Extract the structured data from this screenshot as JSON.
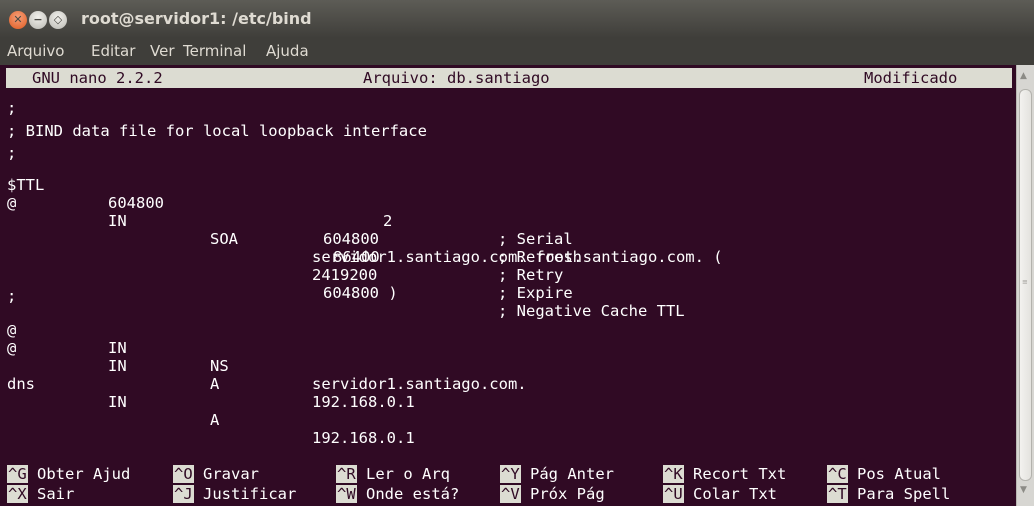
{
  "window": {
    "title": "root@servidor1: /etc/bind",
    "close_glyph": "✕",
    "min_glyph": "−",
    "max_glyph": "◇"
  },
  "menu": [
    "Arquivo",
    "Editar",
    "Ver",
    "Terminal",
    "Ajuda"
  ],
  "nano": {
    "version": "GNU nano 2.2.2",
    "file": "Arquivo: db.santiago",
    "status": "Modificado"
  },
  "file_lines": {
    "l1": ";",
    "l2": "; BIND data file for local loopback interface",
    "l3": ";",
    "l4a": "$TTL",
    "l4b": "604800",
    "l5a": "@",
    "l5b": "IN",
    "l5c": "SOA",
    "l5d": "servidor1.santiago.com. root.santiago.com. (",
    "l6a": "2",
    "l6b": "; Serial",
    "l7a": "604800",
    "l7b": "; Refresh",
    "l8a": "86400",
    "l8b": "; Retry",
    "l9a": "2419200",
    "l9b": "; Expire",
    "l10a": "604800 )",
    "l10b": "; Negative Cache TTL",
    "l11": ";",
    "l12a": "@",
    "l12b": "IN",
    "l12c": "NS",
    "l12d": "servidor1.santiago.com.",
    "l13a": "@",
    "l13b": "IN",
    "l13c": "A",
    "l13d": "192.168.0.1",
    "l15a": "dns",
    "l15b": "IN",
    "l15c": "A",
    "l15d": "192.168.0.1"
  },
  "shortcuts": {
    "row1": [
      {
        "key": "^G",
        "label": "Obter Ajud"
      },
      {
        "key": "^O",
        "label": "Gravar"
      },
      {
        "key": "^R",
        "label": "Ler o Arq"
      },
      {
        "key": "^Y",
        "label": "Pág Anter"
      },
      {
        "key": "^K",
        "label": "Recort Txt"
      },
      {
        "key": "^C",
        "label": "Pos Atual"
      }
    ],
    "row2": [
      {
        "key": "^X",
        "label": "Sair"
      },
      {
        "key": "^J",
        "label": "Justificar"
      },
      {
        "key": "^W",
        "label": "Onde está?"
      },
      {
        "key": "^V",
        "label": "Próx Pág"
      },
      {
        "key": "^U",
        "label": "Colar Txt"
      },
      {
        "key": "^T",
        "label": "Para Spell"
      }
    ]
  },
  "scrollbar": {
    "up_icon": "▲",
    "down_icon": "▼",
    "grip": "≡"
  },
  "colors": {
    "terminal_bg": "#300a24",
    "terminal_fg": "#ffffff",
    "highlight_bg": "#dcdcd2",
    "titlebar_bg": "#3f3e3a",
    "close_button": "#df5a20"
  }
}
